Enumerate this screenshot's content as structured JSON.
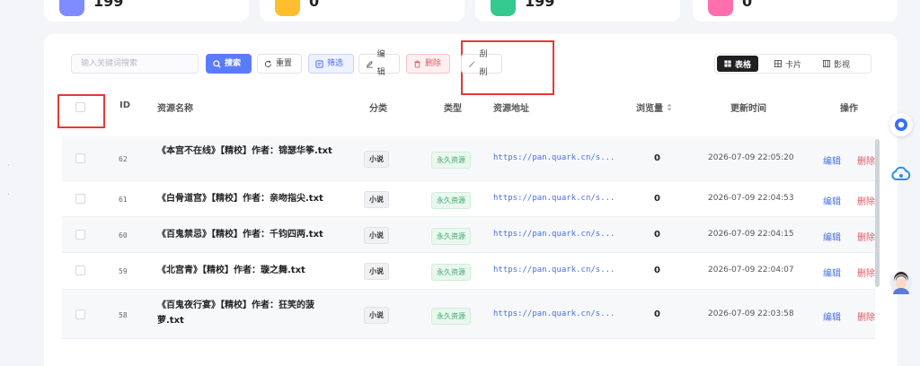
{
  "stats": [
    {
      "value": "199",
      "color": "#7f8cff"
    },
    {
      "value": "0",
      "color": "#ffbe2e"
    },
    {
      "value": "199",
      "color": "#33c98f"
    },
    {
      "value": "0",
      "color": "#ff6fae"
    }
  ],
  "toolbar": {
    "search_placeholder": "输入关键词搜索",
    "search_label": "搜索",
    "reset_label": "重置",
    "filter_label": "筛选",
    "edit_label": "编辑",
    "delete_label": "删除",
    "shave_label": "刮削"
  },
  "view_modes": {
    "table": "表格",
    "card": "卡片",
    "film": "影视"
  },
  "columns": {
    "id": "ID",
    "name": "资源名称",
    "category": "分类",
    "type": "类型",
    "url": "资源地址",
    "views": "浏览量",
    "updated": "更新时间",
    "actions": "操作"
  },
  "rows": [
    {
      "id": "62",
      "name": "《本宫不在线》【精校】作者：锦瑟华筝.txt",
      "category": "小说",
      "type": "永久资源",
      "url": "https://pan.quark.cn/s...",
      "views": "0",
      "updated": "2026-07-09 22:05:20",
      "edit": "编辑",
      "delete": "删除"
    },
    {
      "id": "61",
      "name": "《白骨道宫》【精校】作者：亲吻指尖.txt",
      "category": "小说",
      "type": "永久资源",
      "url": "https://pan.quark.cn/s...",
      "views": "0",
      "updated": "2026-07-09 22:04:53",
      "edit": "编辑",
      "delete": "删除"
    },
    {
      "id": "60",
      "name": "《百鬼禁忌》【精校】作者：千钧四两.txt",
      "category": "小说",
      "type": "永久资源",
      "url": "https://pan.quark.cn/s...",
      "views": "0",
      "updated": "2026-07-09 22:04:15",
      "edit": "编辑",
      "delete": "删除"
    },
    {
      "id": "59",
      "name": "《北宫青》【精校】作者：璇之舞.txt",
      "category": "小说",
      "type": "永久资源",
      "url": "https://pan.quark.cn/s...",
      "views": "0",
      "updated": "2026-07-09 22:04:07",
      "edit": "编辑",
      "delete": "删除"
    },
    {
      "id": "58",
      "name": "《百鬼夜行宴》【精校】作者：狂笑的菠萝.txt",
      "category": "小说",
      "type": "永久资源",
      "url": "https://pan.quark.cn/s...",
      "views": "0",
      "updated": "2026-07-09 22:03:58",
      "edit": "编辑",
      "delete": "删除"
    }
  ]
}
